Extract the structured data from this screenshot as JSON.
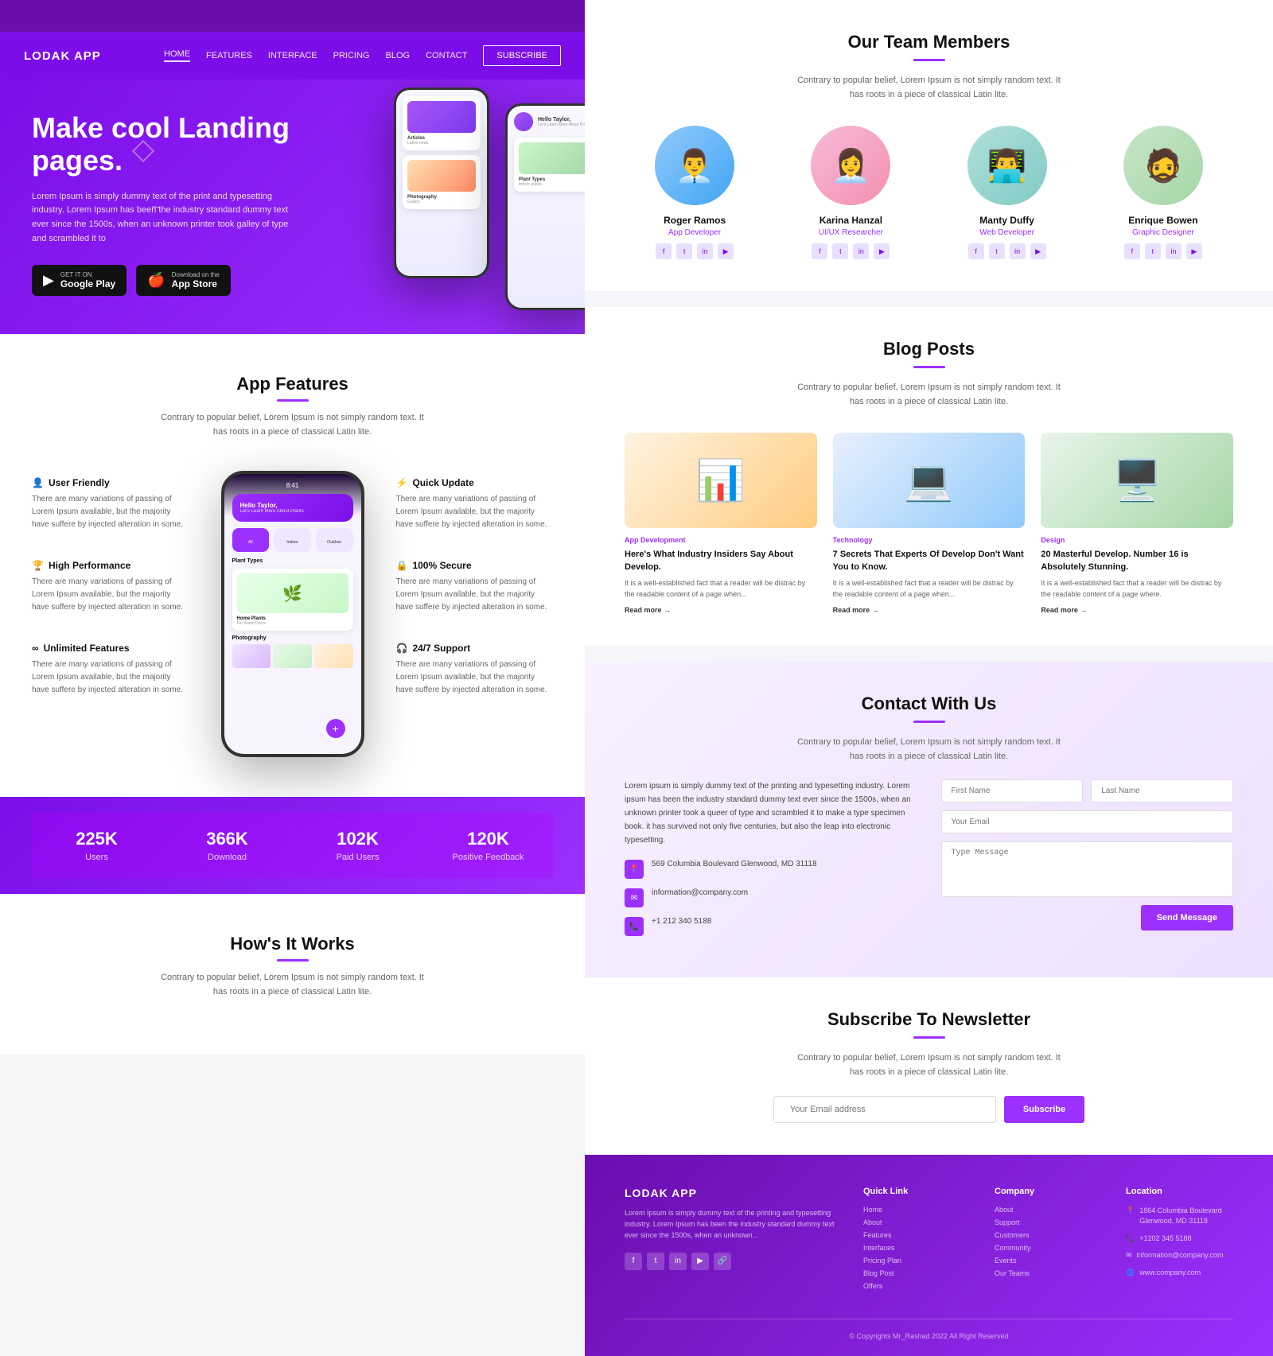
{
  "app": {
    "name": "LODAK APP"
  },
  "nav": {
    "logo": "LODAK APP",
    "links": [
      "HOME",
      "FEATURES",
      "INTERFACE",
      "PRICING",
      "BLOG",
      "CONTACT"
    ],
    "active_link": "HOME",
    "subscribe_label": "SUBSCRIBE"
  },
  "hero": {
    "headline": "Make cool Landing pages.",
    "description": "Lorem Ipsum is simply dummy text of the print and typesetting industry. Lorem Ipsum has been the industry standard dummy text ever since the 1500s, when an unknown printer took galley of type and scrambled it to",
    "google_play_sub": "GET IT ON",
    "google_play_name": "Google Play",
    "app_store_sub": "Download on the",
    "app_store_name": "App Store"
  },
  "features": {
    "section_title": "App Features",
    "section_subtitle": "Contrary to popular belief, Lorem Ipsum is not simply random text. It has roots in a piece of classical Latin lite.",
    "items": [
      {
        "title": "User Friendly",
        "icon": "👤",
        "description": "There are many variations of passing of Lorem Ipsum available, but the majority have suffere by injected alteration in some."
      },
      {
        "title": "Quick Update",
        "icon": "⚡",
        "description": "There are many variations of passing of Lorem Ipsum available, but the majority have suffere by injected alteration in some."
      },
      {
        "title": "High Performance",
        "icon": "🏆",
        "description": "There are many variations of passing of Lorem Ipsum available, but the majority have suffere by injected alteration in some."
      },
      {
        "title": "100% Secure",
        "icon": "🔒",
        "description": "There are many variations of passing of Lorem Ipsum available, but the majority have suffere by injected alteration in some."
      },
      {
        "title": "Unlimited Features",
        "icon": "∞",
        "description": "There are many variations of passing of Lorem Ipsum available, but the majority have suffere by injected alteration in some."
      },
      {
        "title": "24/7 Support",
        "icon": "🎧",
        "description": "There are many variations of passing of Lorem Ipsum available, but the majority have suffere by injected alteration in some."
      }
    ]
  },
  "stats": [
    {
      "number": "225K",
      "label": "Users"
    },
    {
      "number": "366K",
      "label": "Download"
    },
    {
      "number": "102K",
      "label": "Paid Users"
    },
    {
      "number": "120K",
      "label": "Positive Feedback"
    }
  ],
  "how_it_works": {
    "title": "How's It Works",
    "subtitle": "Contrary to popular belief, Lorem Ipsum is not simply random text. It has roots in a piece of classical Latin lite."
  },
  "team": {
    "title": "Our Team Members",
    "subtitle": "Contrary to popular belief, Lorem Ipsum is not simply random text. It has roots in a piece of classical Latin lite.",
    "members": [
      {
        "name": "Roger Ramos",
        "role": "App Developer",
        "avatar": "👨‍💼"
      },
      {
        "name": "Karina Hanzal",
        "role": "UI/UX Researcher",
        "avatar": "👩‍💼"
      },
      {
        "name": "Manty Duffy",
        "role": "Web Developer",
        "avatar": "👨‍💻"
      },
      {
        "name": "Enrique Bowen",
        "role": "Graphic Designer",
        "avatar": "🧔"
      }
    ]
  },
  "blog": {
    "title": "Blog Posts",
    "subtitle": "Contrary to popular belief, Lorem Ipsum is not simply random text. It has roots in a piece of classical Latin lite.",
    "posts": [
      {
        "tag": "App Development",
        "title": "Here's What Industry Insiders Say About Develop.",
        "excerpt": "It is a well-established fact that a reader will be distrac by the readable content of a page when...",
        "read_more": "Read more →"
      },
      {
        "tag": "Technology",
        "title": "7 Secrets That Experts Of Develop Don't Want You to Know.",
        "excerpt": "It is a well-established fact that a reader will be distrac by the readable content of a page when...",
        "read_more": "Read more →"
      },
      {
        "tag": "Design",
        "title": "20 Masterful Develop. Number 16 is Absolutely Stunning.",
        "excerpt": "It is a well-established fact that a reader will be distrac by the readable content of a page where.",
        "read_more": "Read more →"
      }
    ]
  },
  "contact": {
    "title": "Contact With Us",
    "subtitle": "Contrary to popular belief, Lorem Ipsum is not simply random text. It has roots in a piece of classical Latin lite.",
    "info_text": "Lorem ipsum is simply dummy text of the printing and typesetting industry. Lorem ipsum has been the industry standard dummy text ever since the 1500s, when an unknown printer took a queer of type and scrambled it to make a type specimen book. it has survived not only five centuries, but also the leap into electronic typesetting.",
    "address": "569 Columbia Boulevard Glenwood, MD 31118",
    "email": "information@company.com",
    "phone": "+1 212 340 5188",
    "form": {
      "first_name_placeholder": "First Name",
      "last_name_placeholder": "Last Name",
      "email_placeholder": "Your Email",
      "type_message_placeholder": "Type Message",
      "send_button": "Send Message"
    }
  },
  "newsletter": {
    "title": "Subscribe To Newsletter",
    "subtitle": "Contrary to popular belief, Lorem Ipsum is not simply random text. It has roots in a piece of classical Latin lite.",
    "email_placeholder": "Your Email address",
    "button_label": "Subscribe"
  },
  "footer": {
    "logo": "LODAK APP",
    "description": "Lorem Ipsum is simply dummy text of the printing and typesetting industry. Lorem Ipsum has been the industry standard dummy text ever since the 1500s, when an unknown...",
    "quick_link": {
      "title": "Quick Link",
      "links": [
        "Home",
        "About",
        "Features",
        "Interfaces",
        "Pricing Plan",
        "Blog Post",
        "Offers"
      ]
    },
    "company": {
      "title": "Company",
      "links": [
        "About",
        "Support",
        "Customers",
        "Community",
        "Events",
        "Our Teams"
      ]
    },
    "location": {
      "title": "Location",
      "address": "1864 Columbia Boulevard Glenwood, MD 31118",
      "phone": "+1202 345 5188",
      "email": "information@company.com",
      "website": "www.company.com"
    },
    "copyright": "© Copyrights Mr_Rashad 2022 All Right Reserved"
  }
}
